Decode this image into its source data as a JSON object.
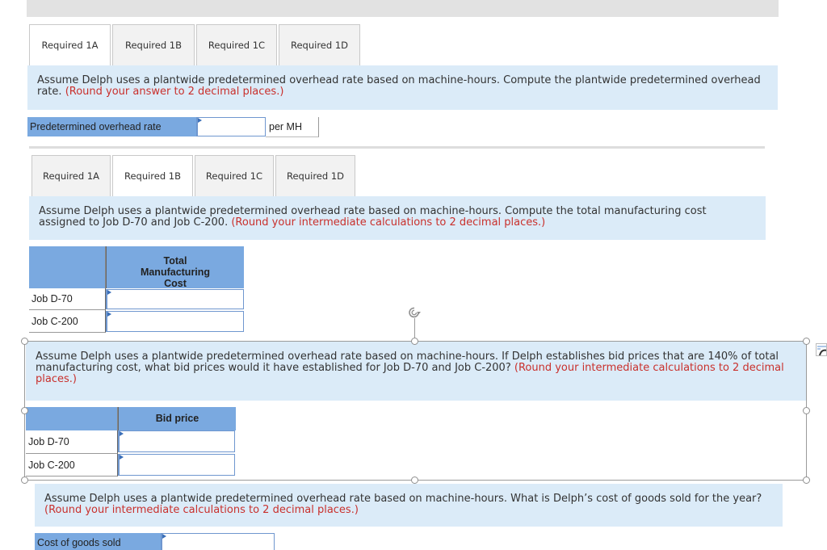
{
  "tabs": [
    "Required 1A",
    "Required 1B",
    "Required 1C",
    "Required 1D"
  ],
  "section_1a": {
    "active_tab": "Required 1A",
    "prompt_text": "Assume Delph uses a plantwide predetermined overhead rate based on machine-hours. Compute the plantwide predetermined overhead rate.",
    "prompt_note": "(Round your answer to 2 decimal places.)",
    "field_label": "Predetermined overhead rate",
    "field_value": "",
    "unit": "per MH"
  },
  "section_1b": {
    "active_tab": "Required 1B",
    "prompt_text": "Assume Delph uses a plantwide predetermined overhead rate based on machine-hours. Compute the total manufacturing cost assigned to Job D-70 and Job C-200.",
    "prompt_note": "(Round your intermediate calculations to 2 decimal places.)",
    "column_header": "Total Manufacturing Cost",
    "rows": [
      {
        "label": "Job D-70",
        "value": ""
      },
      {
        "label": "Job C-200",
        "value": ""
      }
    ]
  },
  "section_1c": {
    "prompt_text": "Assume Delph uses a plantwide predetermined overhead rate based on machine-hours. If Delph establishes bid prices that are 140% of total manufacturing cost, what bid prices would it have established for Job D-70 and Job C-200?",
    "prompt_note": "(Round your intermediate calculations to 2 decimal places.)",
    "column_header": "Bid price",
    "rows": [
      {
        "label": "Job D-70",
        "value": ""
      },
      {
        "label": "Job C-200",
        "value": ""
      }
    ]
  },
  "section_1d": {
    "prompt_text": "Assume Delph uses a plantwide predetermined overhead rate based on machine-hours. What is Delph’s cost of goods sold for the year?",
    "prompt_note": "(Round your intermediate calculations to 2 decimal places.)",
    "field_label": "Cost of goods sold",
    "field_value": ""
  },
  "icons": {
    "rotate": "rotate-handle-icon",
    "layout": "layout-options-icon"
  }
}
